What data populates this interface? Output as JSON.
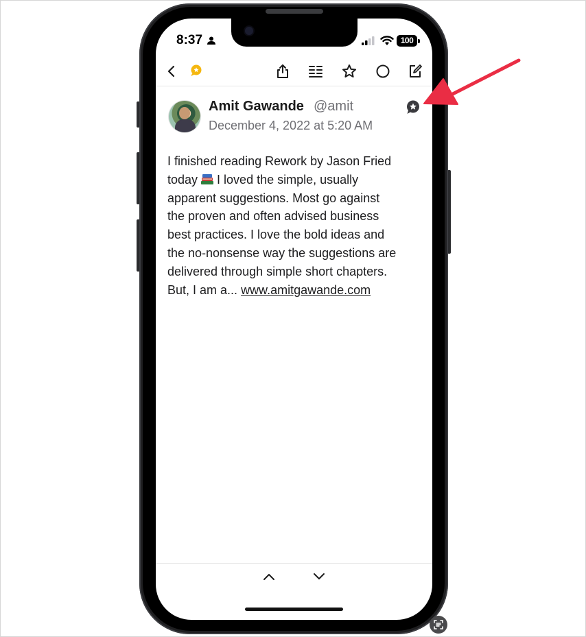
{
  "status_bar": {
    "time": "8:37",
    "battery": "100"
  },
  "toolbar": {
    "icons": [
      "back-chevron-icon",
      "conversation-bubble-icon",
      "share-icon",
      "reader-icon",
      "star-icon",
      "circle-icon",
      "compose-icon"
    ]
  },
  "post": {
    "author_name": "Amit Gawande",
    "author_handle": "@amit",
    "date": "December 4, 2022 at 5:20 AM",
    "body_lines": [
      "I finished reading Rework by Jason Fried",
      "today",
      "I loved the simple, usually",
      "apparent suggestions. Most go against",
      "the proven and often advised business",
      "best practices. I love the bold ideas and",
      "the no-nonsense way the suggestions are",
      "delivered through simple short chapters.",
      "But, I am a..."
    ],
    "link_text": "www.amitgawande.com"
  },
  "colors": {
    "annotation_arrow": "#ea2d44",
    "accent_yellow": "#f5b70f"
  }
}
